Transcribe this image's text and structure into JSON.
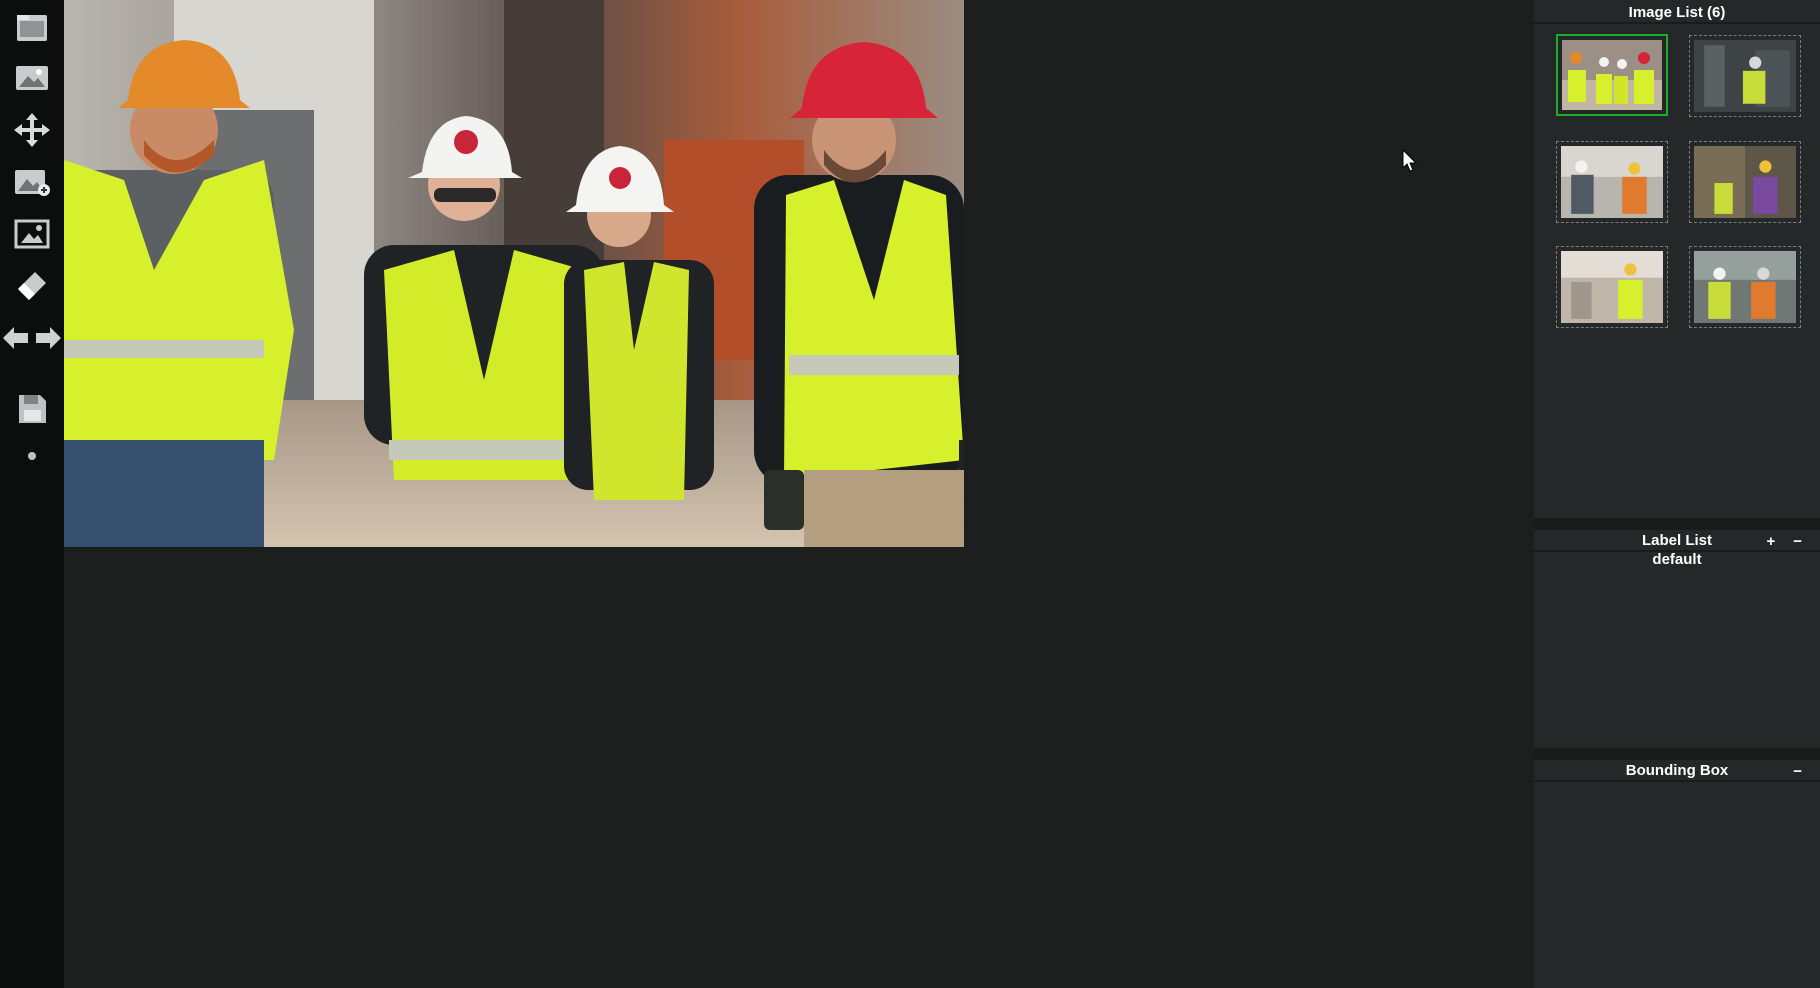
{
  "toolbar": {
    "tools": [
      {
        "name": "open-folder-icon"
      },
      {
        "name": "load-images-icon"
      },
      {
        "name": "move-icon"
      },
      {
        "name": "add-image-icon"
      },
      {
        "name": "crop-image-icon"
      },
      {
        "name": "eraser-icon"
      },
      {
        "name": "prev-next-arrows-icon"
      },
      {
        "name": "save-icon"
      },
      {
        "name": "dot-icon"
      }
    ]
  },
  "image_panel": {
    "title": "Image List (6)",
    "thumbnails": [
      {
        "name": "thumbnail-1",
        "selected": true
      },
      {
        "name": "thumbnail-2",
        "selected": false
      },
      {
        "name": "thumbnail-3",
        "selected": false
      },
      {
        "name": "thumbnail-4",
        "selected": false
      },
      {
        "name": "thumbnail-5",
        "selected": false
      },
      {
        "name": "thumbnail-6",
        "selected": false
      }
    ]
  },
  "label_panel": {
    "title": "Label List",
    "add_label": "+",
    "remove_label": "−",
    "labels": [
      "default"
    ]
  },
  "bbox_panel": {
    "title": "Bounding Box",
    "remove_label": "−"
  },
  "colors": {
    "toolbar_bg": "#0c0d0d",
    "canvas_bg": "#1c1d1d",
    "panel_bg": "#252828",
    "selected_border": "#1faa2a"
  }
}
